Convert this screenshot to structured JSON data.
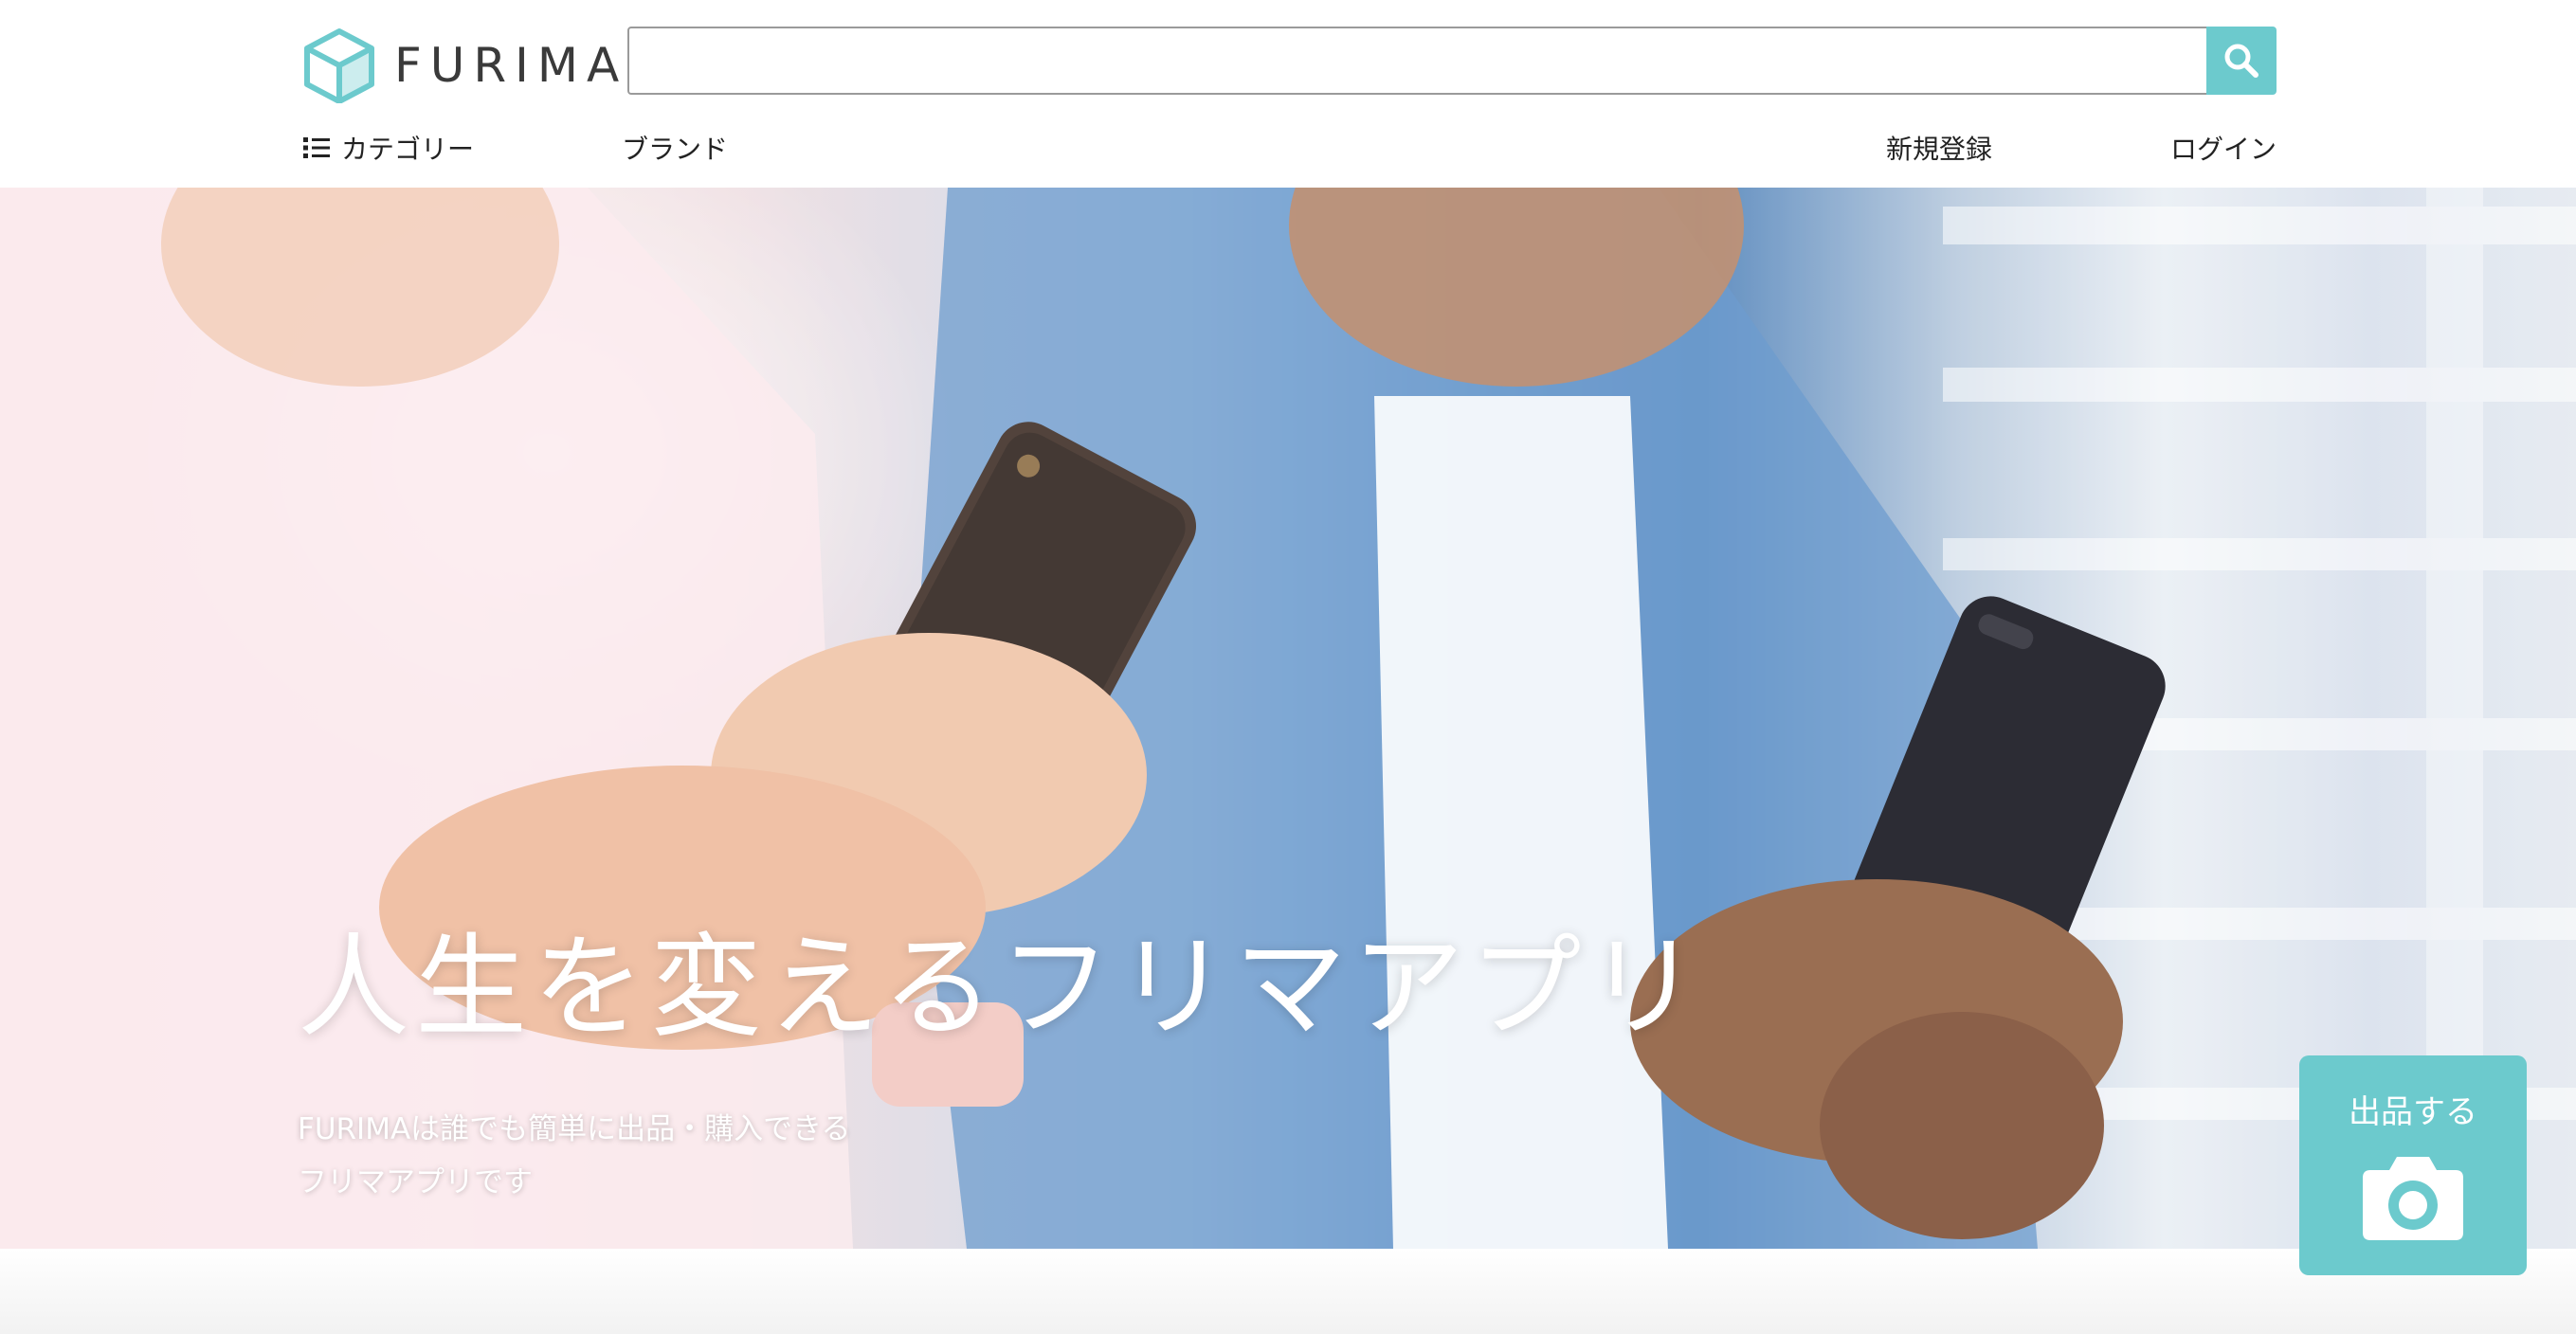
{
  "header": {
    "logo_text": "FURIMA",
    "search": {
      "value": "",
      "placeholder": ""
    },
    "nav": {
      "category_label": "カテゴリー",
      "brand_label": "ブランド",
      "signup_label": "新規登録",
      "login_label": "ログイン"
    }
  },
  "hero": {
    "title": "人生を変えるフリマアプリ",
    "subtitle_line1": "FURIMAは誰でも簡単に出品・購入できる",
    "subtitle_line2": "フリマアプリです"
  },
  "sell_button": {
    "label": "出品する",
    "icon": "camera-icon"
  },
  "colors": {
    "accent": "#6ccacd",
    "text": "#222222"
  },
  "icons": [
    "logo-cube-icon",
    "search-icon",
    "list-icon",
    "camera-icon"
  ]
}
